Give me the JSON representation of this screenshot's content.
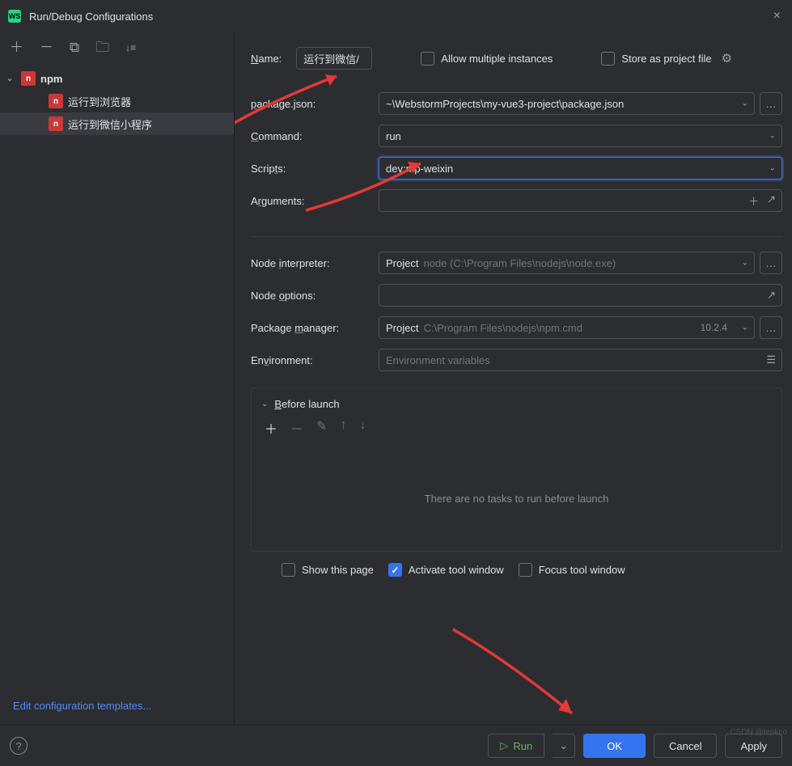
{
  "window": {
    "title": "Run/Debug Configurations"
  },
  "sidebar": {
    "root": "npm",
    "items": [
      "运行到浏览器",
      "运行到微信小程序"
    ],
    "selected_index": 1,
    "edit_templates": "Edit configuration templates..."
  },
  "form": {
    "name_label": "Name:",
    "name_value": "运行到微信/",
    "allow_multiple": "Allow multiple instances",
    "store_as_file": "Store as project file",
    "package_json_label": "package.json:",
    "package_json_value": "~\\WebstormProjects\\my-vue3-project\\package.json",
    "command_label": "Command:",
    "command_value": "run",
    "scripts_label": "Scripts:",
    "scripts_value": "dev:mp-weixin",
    "arguments_label": "Arguments:",
    "arguments_value": "",
    "node_interpreter_label": "Node interpreter:",
    "node_interpreter_prefix": "Project",
    "node_interpreter_value": "node (C:\\Program Files\\nodejs\\node.exe)",
    "node_options_label": "Node options:",
    "node_options_value": "",
    "package_manager_label": "Package manager:",
    "package_manager_prefix": "Project",
    "package_manager_value": "C:\\Program Files\\nodejs\\npm.cmd",
    "package_manager_version": "10.2.4",
    "environment_label": "Environment:",
    "environment_placeholder": "Environment variables"
  },
  "before_launch": {
    "title": "Before launch",
    "empty_text": "There are no tasks to run before launch",
    "show_page": "Show this page",
    "activate_tool": "Activate tool window",
    "focus_tool": "Focus tool window"
  },
  "footer": {
    "run": "Run",
    "ok": "OK",
    "cancel": "Cancel",
    "apply": "Apply"
  },
  "watermark": "CSDN @tepkco"
}
